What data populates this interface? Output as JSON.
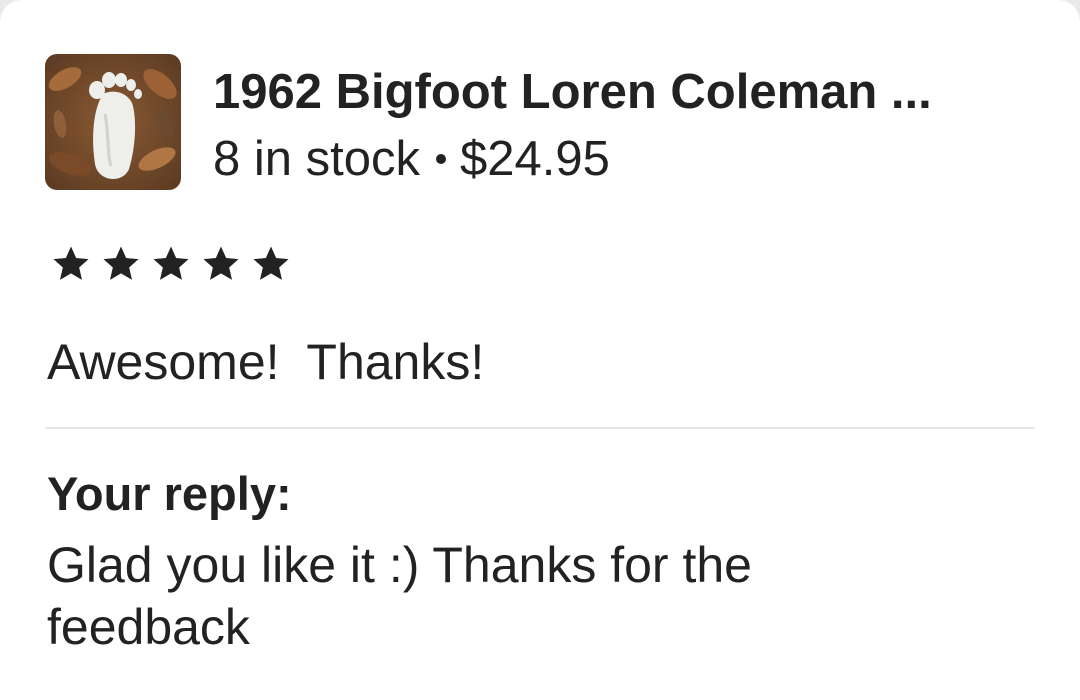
{
  "listing": {
    "title": "1962 Bigfoot Loren Coleman ...",
    "stock": "8 in stock",
    "price": "$24.95",
    "thumbnail": "bigfoot-footprint-cast-photo"
  },
  "review": {
    "rating": 5,
    "max_rating": 5,
    "text": "Awesome!  Thanks!"
  },
  "reply": {
    "label": "Your reply:",
    "text": "Glad you like it :) Thanks for the feedback"
  },
  "colors": {
    "text": "#222222",
    "divider": "#e5e5e5",
    "background": "#ffffff"
  }
}
